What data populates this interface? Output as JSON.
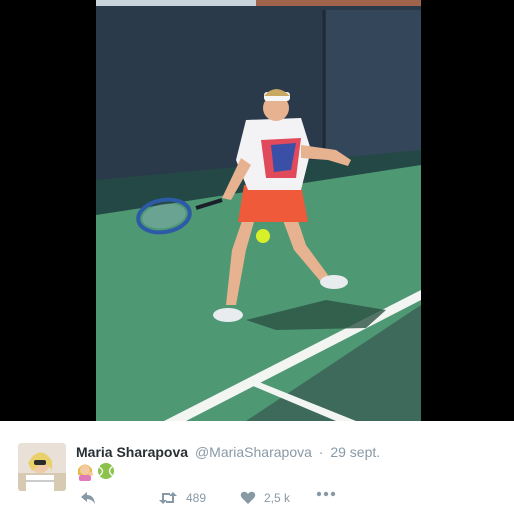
{
  "tweet": {
    "author_name": "Maria Sharapova",
    "handle": "@MariaSharapova",
    "separator": "·",
    "date": "29 sept.",
    "emojis": [
      "woman-tipping-hand-icon",
      "tennis-ball-icon"
    ]
  },
  "actions": {
    "reply_icon": "reply-icon",
    "retweet_icon": "retweet-icon",
    "retweet_count": "489",
    "like_icon": "heart-icon",
    "like_count": "2,5 k",
    "more_icon": "more-dots-icon"
  },
  "colors": {
    "court_green": "#4f9874",
    "court_dark": "#3e6a5b",
    "wall": "#2d3b49",
    "muted_text": "#8899a6",
    "name_text": "#292f33"
  }
}
